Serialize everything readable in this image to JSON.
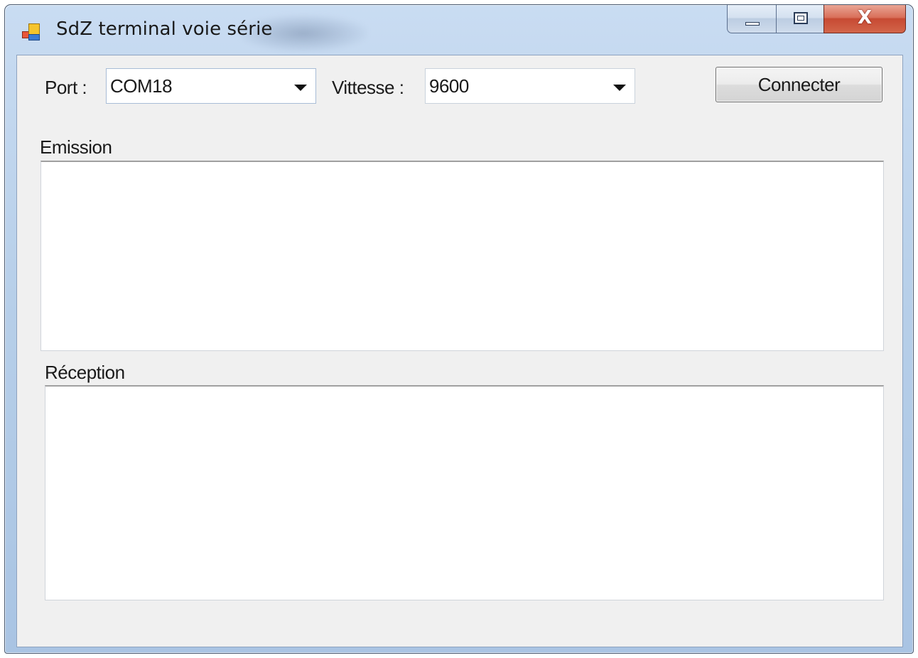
{
  "window": {
    "title": "SdZ terminal voie série"
  },
  "caption_buttons": {
    "minimize": "minimize-icon",
    "maximize": "maximize-icon",
    "close": "close-icon",
    "close_glyph": "X"
  },
  "form": {
    "port_label": "Port :",
    "port_value": "COM18",
    "speed_label": "Vittesse :",
    "speed_value": "9600",
    "connect_button": "Connecter",
    "emission_label": "Emission",
    "emission_text": "",
    "reception_label": "Réception",
    "reception_text": ""
  },
  "colors": {
    "client_background": "#f0f0f0",
    "close_button": "#c74a33",
    "title_bar": "#b7cfe9"
  }
}
